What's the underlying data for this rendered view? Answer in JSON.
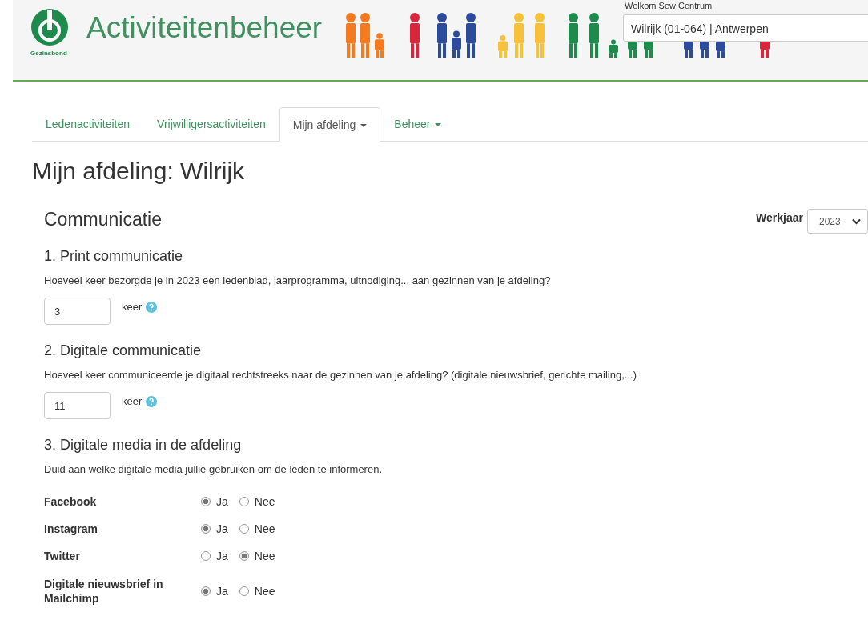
{
  "header": {
    "title": "Activiteitenbeheer",
    "logo_text": "Gezinsbond",
    "welcome": "Welkom Sew Centrum",
    "location_select": "Wilrijk (01-064) | Antwerpen"
  },
  "tabs": [
    {
      "label": "Ledenactiviteiten",
      "selected": false,
      "dropdown": false
    },
    {
      "label": "Vrijwilligersactiviteiten",
      "selected": false,
      "dropdown": false
    },
    {
      "label": "Mijn afdeling",
      "selected": true,
      "dropdown": true
    },
    {
      "label": "Beheer",
      "selected": false,
      "dropdown": true
    }
  ],
  "page_title": "Mijn afdeling: Wilrijk",
  "year_filter": {
    "label": "Werkjaar",
    "value": "2023"
  },
  "section_title": "Communicatie",
  "questions": [
    {
      "kind": "count",
      "title": "1. Print communicatie",
      "text": "Hoeveel keer bezorgde je in 2023 een ledenblad, jaarprogramma, uitnodiging... aan gezinnen van je afdeling?",
      "value": "3",
      "unit": "keer"
    },
    {
      "kind": "count",
      "title": "2. Digitale communicatie",
      "text": "Hoeveel keer communiceerde je digitaal rechtstreeks naar de gezinnen van je afdeling? (digitale nieuwsbrief, gerichte mailing,...)",
      "value": "11",
      "unit": "keer"
    },
    {
      "kind": "choices",
      "title": "3. Digitale media in de afdeling",
      "text": "Duid aan welke digitale media jullie gebruiken om de leden te informeren.",
      "items": [
        {
          "label": "Facebook",
          "options": [
            {
              "label": "Ja",
              "selected": true
            },
            {
              "label": "Nee",
              "selected": false
            }
          ]
        },
        {
          "label": "Instagram",
          "options": [
            {
              "label": "Ja",
              "selected": true
            },
            {
              "label": "Nee",
              "selected": false
            }
          ]
        },
        {
          "label": "Twitter",
          "options": [
            {
              "label": "Ja",
              "selected": false
            },
            {
              "label": "Nee",
              "selected": true
            }
          ]
        },
        {
          "label": "Digitale nieuwsbrief in Mailchimp",
          "options": [
            {
              "label": "Ja",
              "selected": true
            },
            {
              "label": "Nee",
              "selected": false
            }
          ]
        }
      ]
    }
  ]
}
